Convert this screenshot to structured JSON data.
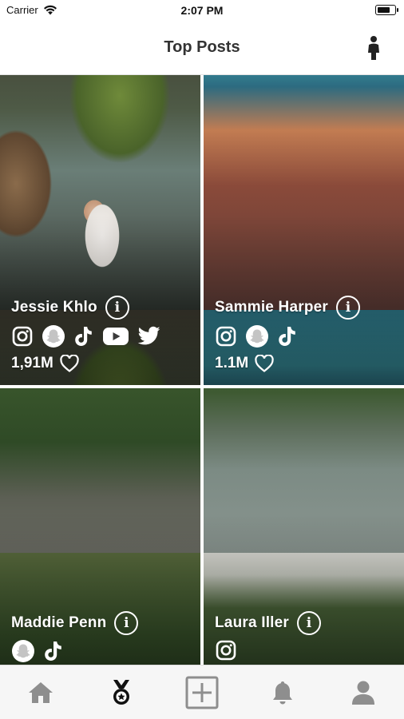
{
  "status_bar": {
    "carrier": "Carrier",
    "time": "2:07 PM",
    "battery_level": 0.8
  },
  "nav": {
    "title": "Top Posts",
    "right_icon": "person-icon"
  },
  "cards": [
    {
      "name": "Jessie Khlo",
      "socials": [
        "instagram-icon",
        "snapchat-icon",
        "tiktok-icon",
        "youtube-icon",
        "twitter-icon"
      ],
      "likes": "1,91M"
    },
    {
      "name": "Sammie Harper",
      "socials": [
        "instagram-icon",
        "snapchat-icon",
        "tiktok-icon"
      ],
      "likes": "1.1M"
    },
    {
      "name": "Maddie Penn",
      "socials": [
        "snapchat-icon",
        "tiktok-icon"
      ],
      "likes": ""
    },
    {
      "name": "Laura Iller",
      "socials": [
        "instagram-icon"
      ],
      "likes": ""
    }
  ],
  "tab_bar": {
    "tabs": [
      "home-icon",
      "medal-icon",
      "add-post-icon",
      "bell-icon",
      "profile-icon"
    ],
    "active_index": 1,
    "colors": {
      "inactive": "#8e8e8e",
      "active": "#111111"
    }
  }
}
